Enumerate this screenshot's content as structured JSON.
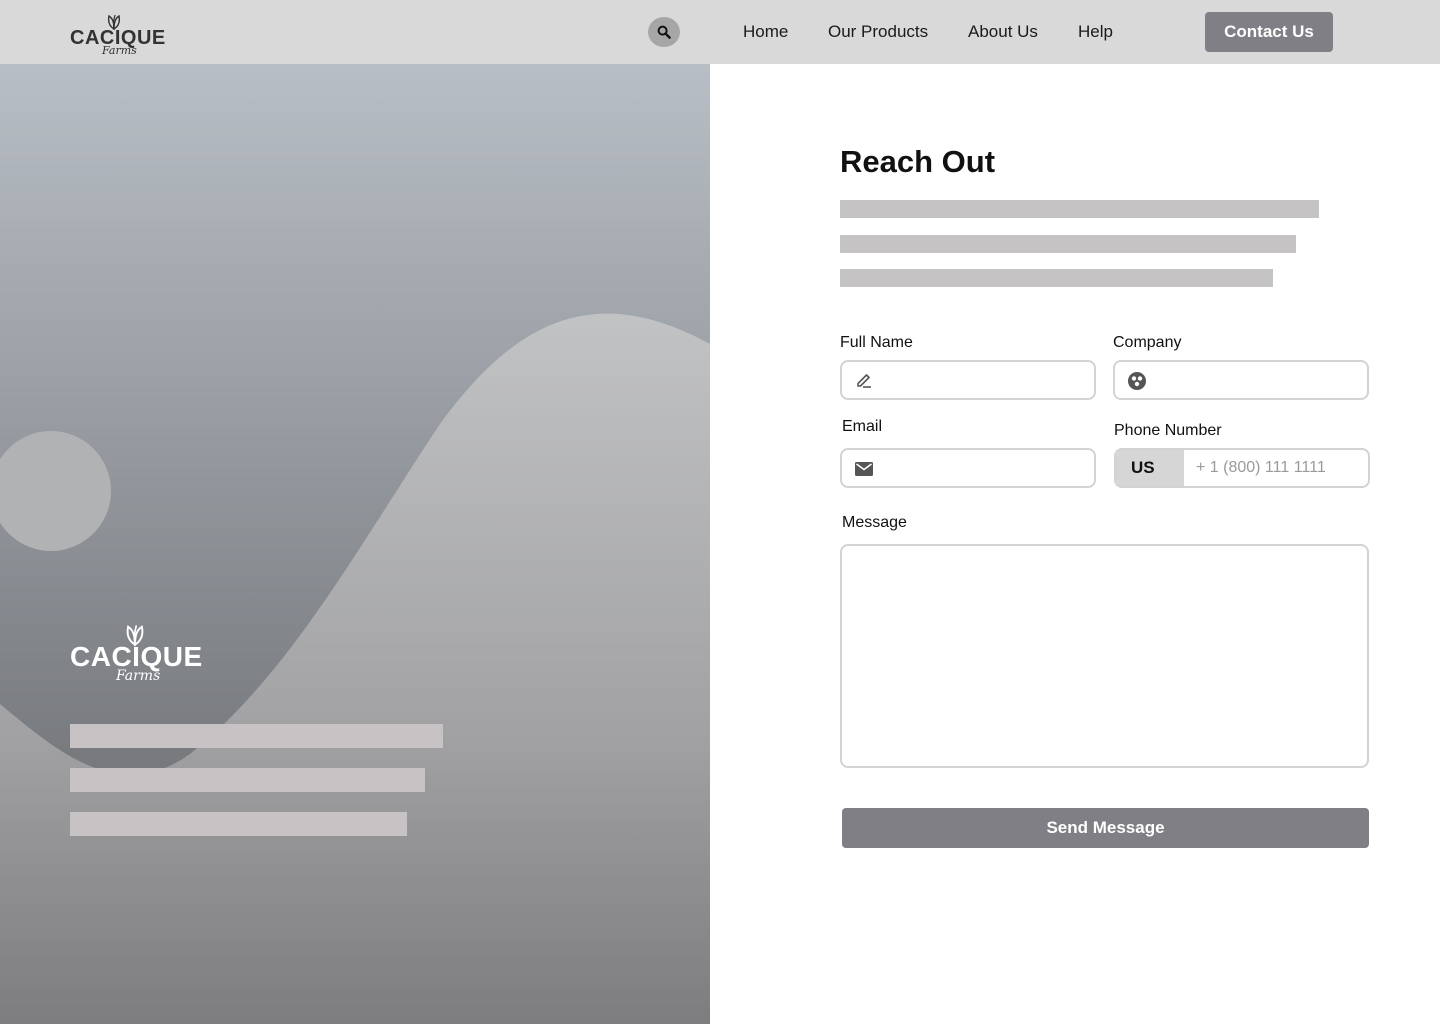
{
  "header": {
    "brand": {
      "name": "CACIQUE",
      "tagline": "Farms",
      "logo_icon": "leaf-icon"
    },
    "search_icon": "search-icon",
    "nav": [
      {
        "label": "Home"
      },
      {
        "label": "Our Products"
      },
      {
        "label": "About Us"
      },
      {
        "label": "Help"
      }
    ],
    "cta_label": "Contact Us"
  },
  "hero": {
    "brand": {
      "name": "CACIQUE",
      "tagline": "Farms",
      "logo_icon": "leaf-icon"
    }
  },
  "form": {
    "title": "Reach Out",
    "fields": {
      "full_name": {
        "label": "Full Name",
        "value": "",
        "icon": "pencil-icon"
      },
      "company": {
        "label": "Company",
        "value": "",
        "icon": "company-icon"
      },
      "email": {
        "label": "Email",
        "value": "",
        "icon": "envelope-icon"
      },
      "phone": {
        "label": "Phone Number",
        "country": "US",
        "placeholder": "+ 1 (800) 111 1111",
        "value": ""
      },
      "message": {
        "label": "Message",
        "value": ""
      }
    },
    "submit_label": "Send Message"
  },
  "colors": {
    "header_bg": "#d9d9d9",
    "button_bg": "#7f7f85",
    "placeholder_bar": "#c6c3c5",
    "field_border": "#d3d3d3"
  }
}
